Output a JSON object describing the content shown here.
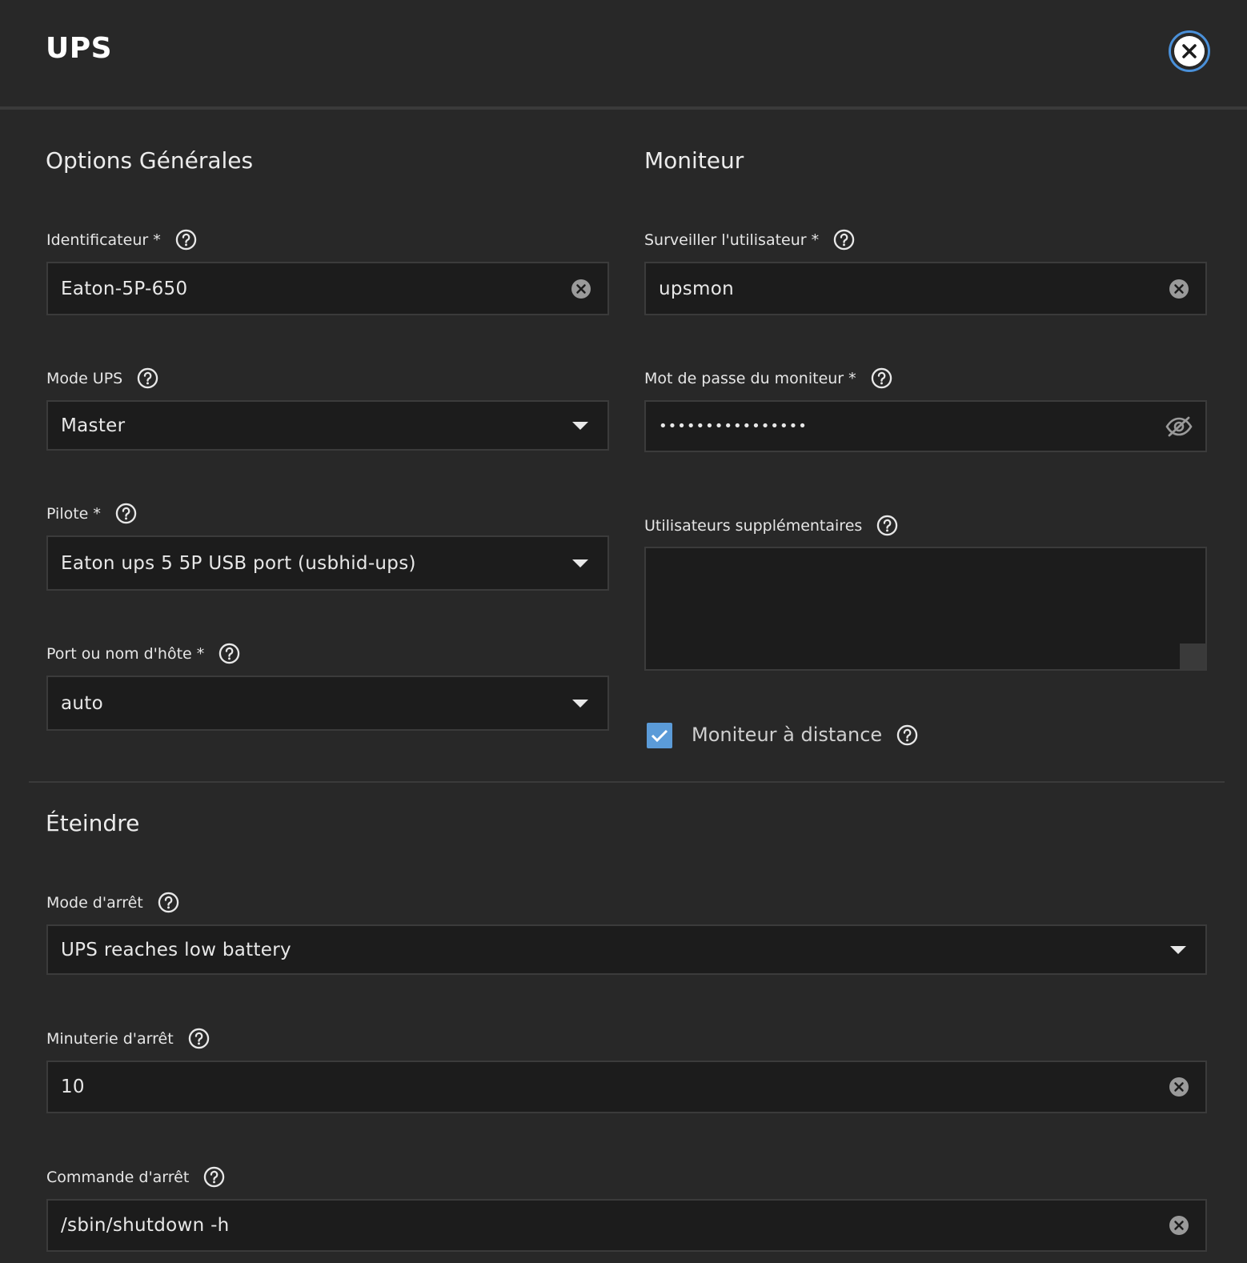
{
  "header": {
    "title": "UPS"
  },
  "general": {
    "title": "Options Générales",
    "identifier": {
      "label": "Identificateur *",
      "value": "Eaton-5P-650"
    },
    "mode": {
      "label": "Mode UPS",
      "value": "Master"
    },
    "driver": {
      "label": "Pilote *",
      "value": "Eaton ups 5 5P USB port (usbhid-ups)"
    },
    "port": {
      "label": "Port ou nom d'hôte *",
      "value": "auto"
    }
  },
  "monitor": {
    "title": "Moniteur",
    "user": {
      "label": "Surveiller l'utilisateur *",
      "value": "upsmon"
    },
    "password": {
      "label": "Mot de passe du moniteur *",
      "value": "••••••••••••••••"
    },
    "extra_users": {
      "label": "Utilisateurs supplémentaires",
      "value": ""
    },
    "remote": {
      "label": "Moniteur à distance",
      "checked": true
    }
  },
  "shutdown": {
    "title": "Éteindre",
    "mode": {
      "label": "Mode d'arrêt",
      "value": "UPS reaches low battery"
    },
    "timer": {
      "label": "Minuterie d'arrêt",
      "value": "10"
    },
    "command": {
      "label": "Commande d'arrêt",
      "value": "/sbin/shutdown -h"
    }
  },
  "colors": {
    "accent": "#5b9bd8",
    "close_ring": "#4a90d9",
    "background": "#282828",
    "input": "#1c1c1c"
  }
}
